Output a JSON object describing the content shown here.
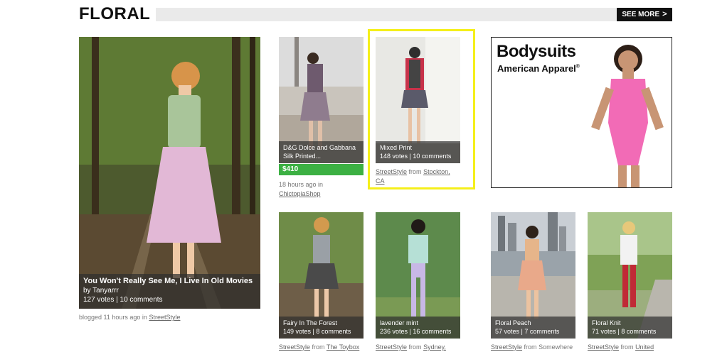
{
  "header": {
    "title": "FLORAL",
    "see_more": "SEE MORE",
    "see_more_arrow": ">"
  },
  "feature": {
    "title": "You Won't Really See Me, I Live In Old Movies",
    "by": "by Tanyarrr",
    "stats": "127 votes | 10 comments",
    "meta_prefix": "blogged 11 hours ago in",
    "meta_link": "StreetStyle"
  },
  "cards": [
    {
      "title": "D&G Dolce and Gabbana Silk Printed...",
      "price": "$410",
      "meta_line1": "18 hours ago in",
      "meta_link": "ChictopiaShop"
    },
    {
      "title": "Mixed Print",
      "stats": "148 votes | 10 comments",
      "meta_link": "StreetStyle",
      "meta_from": "from",
      "meta_place_line1": "Stockton,",
      "meta_place_line2": "CA"
    },
    {
      "title": "Fairy In The Forest",
      "stats": "149 votes | 8 comments",
      "meta_link": "StreetStyle",
      "meta_from": "from",
      "meta_place": "The Toybox"
    },
    {
      "title": "lavender mint",
      "stats": "236 votes | 16 comments",
      "meta_link": "StreetStyle",
      "meta_from": "from",
      "meta_place": "Sydney,"
    },
    {
      "title": "Floral Peach",
      "stats": "57 votes | 7 comments",
      "meta_link": "StreetStyle",
      "meta_from": "from",
      "meta_place": "Somewhere"
    },
    {
      "title": "Floral Knit",
      "stats": "71 votes | 8 comments",
      "meta_link": "StreetStyle",
      "meta_from": "from",
      "meta_place": "United"
    }
  ],
  "ad": {
    "headline": "Bodysuits",
    "brand": "American Apparel",
    "brand_mark": "®"
  },
  "colors": {
    "highlight": "#f5ef1a",
    "price_bg": "#3cb043",
    "header_bar": "#eaeaea"
  }
}
